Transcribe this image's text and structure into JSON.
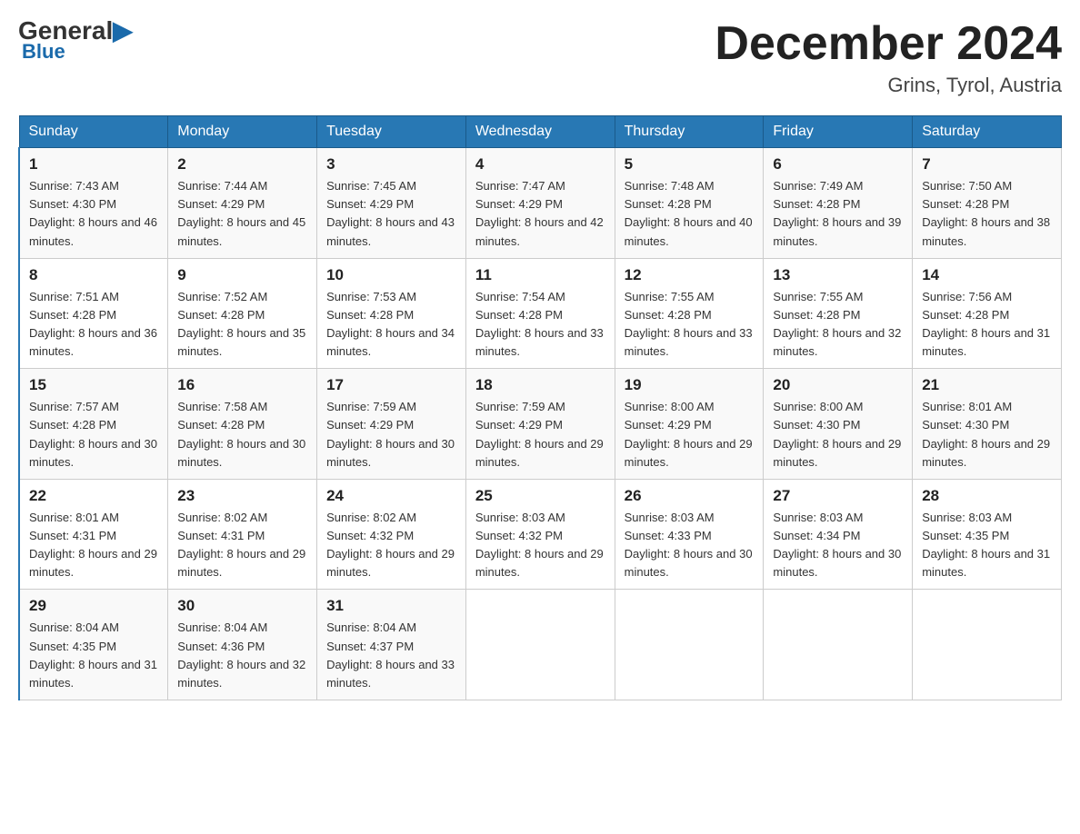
{
  "header": {
    "logo_general": "General",
    "logo_blue": "Blue",
    "title": "December 2024",
    "location": "Grins, Tyrol, Austria"
  },
  "days_of_week": [
    "Sunday",
    "Monday",
    "Tuesday",
    "Wednesday",
    "Thursday",
    "Friday",
    "Saturday"
  ],
  "weeks": [
    [
      {
        "day": "1",
        "sunrise": "7:43 AM",
        "sunset": "4:30 PM",
        "daylight": "8 hours and 46 minutes."
      },
      {
        "day": "2",
        "sunrise": "7:44 AM",
        "sunset": "4:29 PM",
        "daylight": "8 hours and 45 minutes."
      },
      {
        "day": "3",
        "sunrise": "7:45 AM",
        "sunset": "4:29 PM",
        "daylight": "8 hours and 43 minutes."
      },
      {
        "day": "4",
        "sunrise": "7:47 AM",
        "sunset": "4:29 PM",
        "daylight": "8 hours and 42 minutes."
      },
      {
        "day": "5",
        "sunrise": "7:48 AM",
        "sunset": "4:28 PM",
        "daylight": "8 hours and 40 minutes."
      },
      {
        "day": "6",
        "sunrise": "7:49 AM",
        "sunset": "4:28 PM",
        "daylight": "8 hours and 39 minutes."
      },
      {
        "day": "7",
        "sunrise": "7:50 AM",
        "sunset": "4:28 PM",
        "daylight": "8 hours and 38 minutes."
      }
    ],
    [
      {
        "day": "8",
        "sunrise": "7:51 AM",
        "sunset": "4:28 PM",
        "daylight": "8 hours and 36 minutes."
      },
      {
        "day": "9",
        "sunrise": "7:52 AM",
        "sunset": "4:28 PM",
        "daylight": "8 hours and 35 minutes."
      },
      {
        "day": "10",
        "sunrise": "7:53 AM",
        "sunset": "4:28 PM",
        "daylight": "8 hours and 34 minutes."
      },
      {
        "day": "11",
        "sunrise": "7:54 AM",
        "sunset": "4:28 PM",
        "daylight": "8 hours and 33 minutes."
      },
      {
        "day": "12",
        "sunrise": "7:55 AM",
        "sunset": "4:28 PM",
        "daylight": "8 hours and 33 minutes."
      },
      {
        "day": "13",
        "sunrise": "7:55 AM",
        "sunset": "4:28 PM",
        "daylight": "8 hours and 32 minutes."
      },
      {
        "day": "14",
        "sunrise": "7:56 AM",
        "sunset": "4:28 PM",
        "daylight": "8 hours and 31 minutes."
      }
    ],
    [
      {
        "day": "15",
        "sunrise": "7:57 AM",
        "sunset": "4:28 PM",
        "daylight": "8 hours and 30 minutes."
      },
      {
        "day": "16",
        "sunrise": "7:58 AM",
        "sunset": "4:28 PM",
        "daylight": "8 hours and 30 minutes."
      },
      {
        "day": "17",
        "sunrise": "7:59 AM",
        "sunset": "4:29 PM",
        "daylight": "8 hours and 30 minutes."
      },
      {
        "day": "18",
        "sunrise": "7:59 AM",
        "sunset": "4:29 PM",
        "daylight": "8 hours and 29 minutes."
      },
      {
        "day": "19",
        "sunrise": "8:00 AM",
        "sunset": "4:29 PM",
        "daylight": "8 hours and 29 minutes."
      },
      {
        "day": "20",
        "sunrise": "8:00 AM",
        "sunset": "4:30 PM",
        "daylight": "8 hours and 29 minutes."
      },
      {
        "day": "21",
        "sunrise": "8:01 AM",
        "sunset": "4:30 PM",
        "daylight": "8 hours and 29 minutes."
      }
    ],
    [
      {
        "day": "22",
        "sunrise": "8:01 AM",
        "sunset": "4:31 PM",
        "daylight": "8 hours and 29 minutes."
      },
      {
        "day": "23",
        "sunrise": "8:02 AM",
        "sunset": "4:31 PM",
        "daylight": "8 hours and 29 minutes."
      },
      {
        "day": "24",
        "sunrise": "8:02 AM",
        "sunset": "4:32 PM",
        "daylight": "8 hours and 29 minutes."
      },
      {
        "day": "25",
        "sunrise": "8:03 AM",
        "sunset": "4:32 PM",
        "daylight": "8 hours and 29 minutes."
      },
      {
        "day": "26",
        "sunrise": "8:03 AM",
        "sunset": "4:33 PM",
        "daylight": "8 hours and 30 minutes."
      },
      {
        "day": "27",
        "sunrise": "8:03 AM",
        "sunset": "4:34 PM",
        "daylight": "8 hours and 30 minutes."
      },
      {
        "day": "28",
        "sunrise": "8:03 AM",
        "sunset": "4:35 PM",
        "daylight": "8 hours and 31 minutes."
      }
    ],
    [
      {
        "day": "29",
        "sunrise": "8:04 AM",
        "sunset": "4:35 PM",
        "daylight": "8 hours and 31 minutes."
      },
      {
        "day": "30",
        "sunrise": "8:04 AM",
        "sunset": "4:36 PM",
        "daylight": "8 hours and 32 minutes."
      },
      {
        "day": "31",
        "sunrise": "8:04 AM",
        "sunset": "4:37 PM",
        "daylight": "8 hours and 33 minutes."
      },
      null,
      null,
      null,
      null
    ]
  ]
}
